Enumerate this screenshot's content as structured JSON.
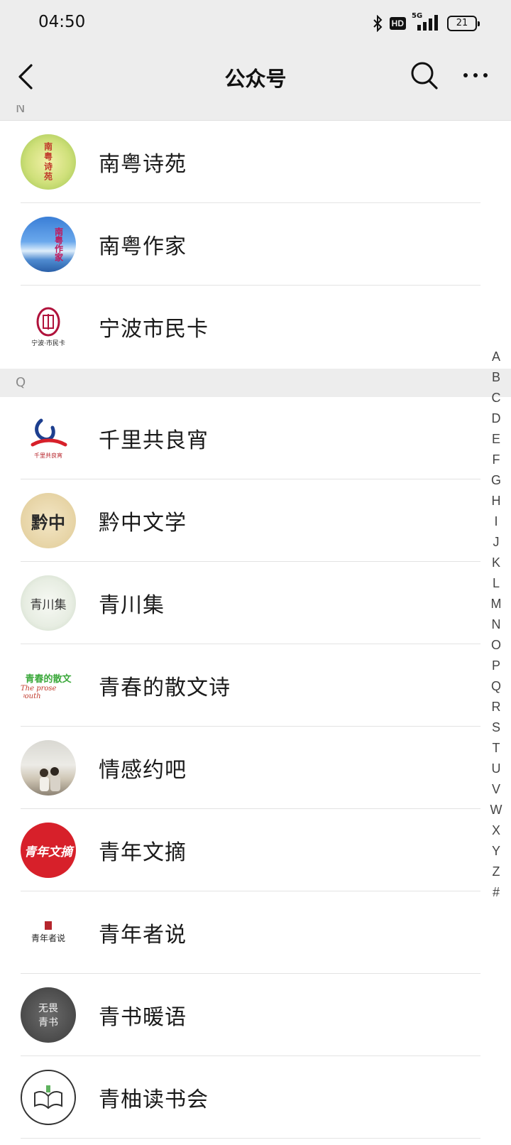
{
  "status": {
    "time": "04:50",
    "hd": "HD",
    "network": "5G",
    "battery": "21"
  },
  "nav": {
    "title": "公众号"
  },
  "sections": [
    {
      "letter": "N"
    },
    {
      "letter": "Q"
    }
  ],
  "accounts": [
    {
      "name": "南粤诗苑"
    },
    {
      "name": "南粤作家"
    },
    {
      "name": "宁波市民卡"
    },
    {
      "name": "千里共良宵"
    },
    {
      "name": "黔中文学"
    },
    {
      "name": "青川集"
    },
    {
      "name": "青春的散文诗"
    },
    {
      "name": "情感约吧"
    },
    {
      "name": "青年文摘"
    },
    {
      "name": "青年者说"
    },
    {
      "name": "青书暖语"
    },
    {
      "name": "青柚读书会"
    }
  ],
  "avatar_text": {
    "nanyue_shiyuan": "南粤诗苑",
    "nanyue_zuojia": "南粤作家",
    "ningbo": "宁波·市民卡",
    "qianli": "千里共良宵",
    "qianzhong": "黔中",
    "qingchuan": "青川集",
    "qingchun_cn": "青春的散文",
    "qingchun_en": "The prose youth",
    "qingnian_wenzhai": "青年文摘",
    "qingnian_zheshuo": "青年者说",
    "qingshu_top": "无畏",
    "qingshu_bottom": "青书"
  },
  "index_letters": [
    "A",
    "B",
    "C",
    "D",
    "E",
    "F",
    "G",
    "H",
    "I",
    "J",
    "K",
    "L",
    "M",
    "N",
    "O",
    "P",
    "Q",
    "R",
    "S",
    "T",
    "U",
    "V",
    "W",
    "X",
    "Y",
    "Z",
    "#"
  ],
  "colors": {
    "bar_bg": "#ededed",
    "divider": "#e3e3e3",
    "section_text": "#8a8a8a",
    "qingnian_red": "#d7202a"
  }
}
